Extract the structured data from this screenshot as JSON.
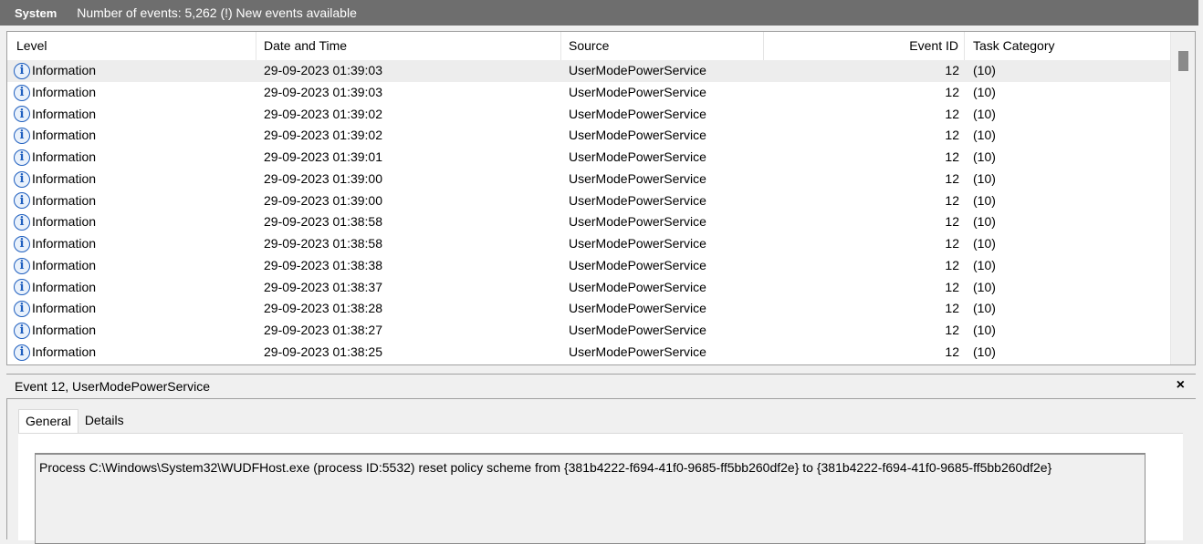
{
  "titlebar": {
    "log_name": "System",
    "summary": "Number of events: 5,262 (!) New events available"
  },
  "columns": {
    "level": "Level",
    "datetime": "Date and Time",
    "source": "Source",
    "event_id": "Event ID",
    "task_category": "Task Category"
  },
  "events": [
    {
      "level": "Information",
      "datetime": "29-09-2023 01:39:03",
      "source": "UserModePowerService",
      "event_id": "12",
      "task": "(10)"
    },
    {
      "level": "Information",
      "datetime": "29-09-2023 01:39:03",
      "source": "UserModePowerService",
      "event_id": "12",
      "task": "(10)"
    },
    {
      "level": "Information",
      "datetime": "29-09-2023 01:39:02",
      "source": "UserModePowerService",
      "event_id": "12",
      "task": "(10)"
    },
    {
      "level": "Information",
      "datetime": "29-09-2023 01:39:02",
      "source": "UserModePowerService",
      "event_id": "12",
      "task": "(10)"
    },
    {
      "level": "Information",
      "datetime": "29-09-2023 01:39:01",
      "source": "UserModePowerService",
      "event_id": "12",
      "task": "(10)"
    },
    {
      "level": "Information",
      "datetime": "29-09-2023 01:39:00",
      "source": "UserModePowerService",
      "event_id": "12",
      "task": "(10)"
    },
    {
      "level": "Information",
      "datetime": "29-09-2023 01:39:00",
      "source": "UserModePowerService",
      "event_id": "12",
      "task": "(10)"
    },
    {
      "level": "Information",
      "datetime": "29-09-2023 01:38:58",
      "source": "UserModePowerService",
      "event_id": "12",
      "task": "(10)"
    },
    {
      "level": "Information",
      "datetime": "29-09-2023 01:38:58",
      "source": "UserModePowerService",
      "event_id": "12",
      "task": "(10)"
    },
    {
      "level": "Information",
      "datetime": "29-09-2023 01:38:38",
      "source": "UserModePowerService",
      "event_id": "12",
      "task": "(10)"
    },
    {
      "level": "Information",
      "datetime": "29-09-2023 01:38:37",
      "source": "UserModePowerService",
      "event_id": "12",
      "task": "(10)"
    },
    {
      "level": "Information",
      "datetime": "29-09-2023 01:38:28",
      "source": "UserModePowerService",
      "event_id": "12",
      "task": "(10)"
    },
    {
      "level": "Information",
      "datetime": "29-09-2023 01:38:27",
      "source": "UserModePowerService",
      "event_id": "12",
      "task": "(10)"
    },
    {
      "level": "Information",
      "datetime": "29-09-2023 01:38:25",
      "source": "UserModePowerService",
      "event_id": "12",
      "task": "(10)"
    }
  ],
  "selected_index": 0,
  "icons": {
    "level_icon": "info-icon",
    "close_icon": "close-icon"
  },
  "detail": {
    "title": "Event 12, UserModePowerService",
    "close_glyph": "×",
    "tabs": [
      "General",
      "Details"
    ],
    "active_tab": "General",
    "message": "Process C:\\Windows\\System32\\WUDFHost.exe (process ID:5532) reset policy scheme from {381b4222-f694-41f0-9685-ff5bb260df2e} to {381b4222-f694-41f0-9685-ff5bb260df2e}"
  }
}
